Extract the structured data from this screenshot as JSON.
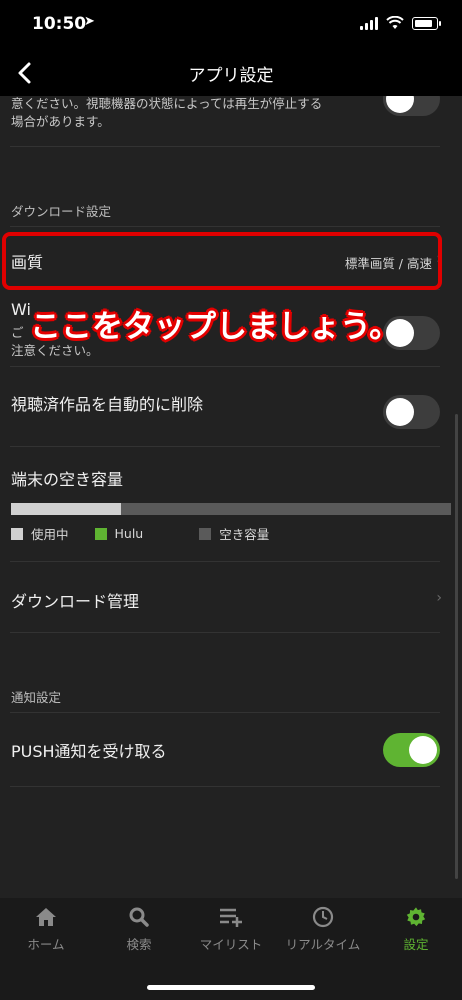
{
  "status": {
    "time": "10:50"
  },
  "nav": {
    "title": "アプリ設定",
    "back_icon": "chevron-left-icon"
  },
  "streaming": {
    "note_line1": "意ください。視聴機器の状態によっては再生が停止する",
    "note_line2": "場合があります。",
    "toggle_on": false
  },
  "download_section": {
    "header": "ダウンロード設定",
    "quality": {
      "label": "画質",
      "value": "標準画質 / 高速"
    },
    "wifi": {
      "label": "Wi",
      "note_line1": "ご",
      "note_line2": "注意ください。",
      "toggle_on": false
    },
    "auto_delete": {
      "label": "視聴済作品を自動的に削除",
      "toggle_on": false
    },
    "storage": {
      "label": "端末の空き容量",
      "used_fraction": 0.25,
      "legend": [
        {
          "label": "使用中",
          "color": "#d0d0d0"
        },
        {
          "label": "Hulu",
          "color": "#5fb432"
        },
        {
          "label": "空き容量",
          "color": "#5a5a5a"
        }
      ]
    },
    "manage": {
      "label": "ダウンロード管理"
    }
  },
  "notification_section": {
    "header": "通知設定",
    "push": {
      "label": "PUSH通知を受け取る",
      "toggle_on": true
    }
  },
  "annotation": {
    "text": "ここをタップしましょう。"
  },
  "tabs": [
    {
      "label": "ホーム",
      "icon": "home-icon"
    },
    {
      "label": "検索",
      "icon": "search-icon"
    },
    {
      "label": "マイリスト",
      "icon": "mylist-icon"
    },
    {
      "label": "リアルタイム",
      "icon": "clock-icon"
    },
    {
      "label": "設定",
      "icon": "gear-icon",
      "active": true
    }
  ],
  "colors": {
    "accent": "#5fb432",
    "highlight": "#e00000",
    "background": "#222222"
  }
}
